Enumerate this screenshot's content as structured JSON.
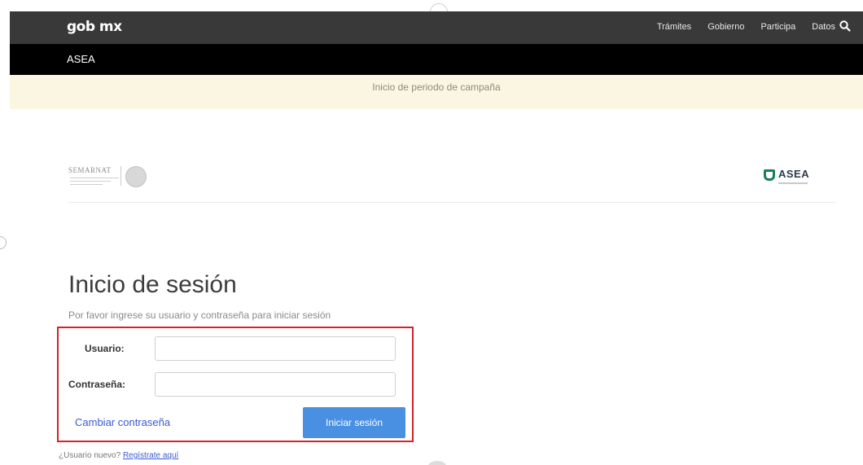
{
  "header": {
    "logo": "gob mx",
    "nav": [
      "Trámites",
      "Gobierno",
      "Participa",
      "Datos"
    ],
    "search_icon": "search-icon"
  },
  "subheader": {
    "label": "ASEA"
  },
  "banner": {
    "text": "Inicio de periodo de campaña"
  },
  "logos": {
    "left_text": "SEMARNAT",
    "right_text": "ASEA",
    "brand_color": "#1a7f5a"
  },
  "login": {
    "title": "Inicio de sesión",
    "subtitle": "Por favor ingrese su usuario y contraseña para iniciar sesión",
    "user_label": "Usuario:",
    "user_value": "",
    "password_label": "Contraseña:",
    "password_value": "",
    "change_password": "Cambiar contraseña",
    "submit": "Iniciar sesión",
    "highlight_color": "#d6202a",
    "button_color": "#4a90e2"
  },
  "register": {
    "prompt": "¿Usuario nuevo?",
    "link": "Regístrate aquí"
  }
}
